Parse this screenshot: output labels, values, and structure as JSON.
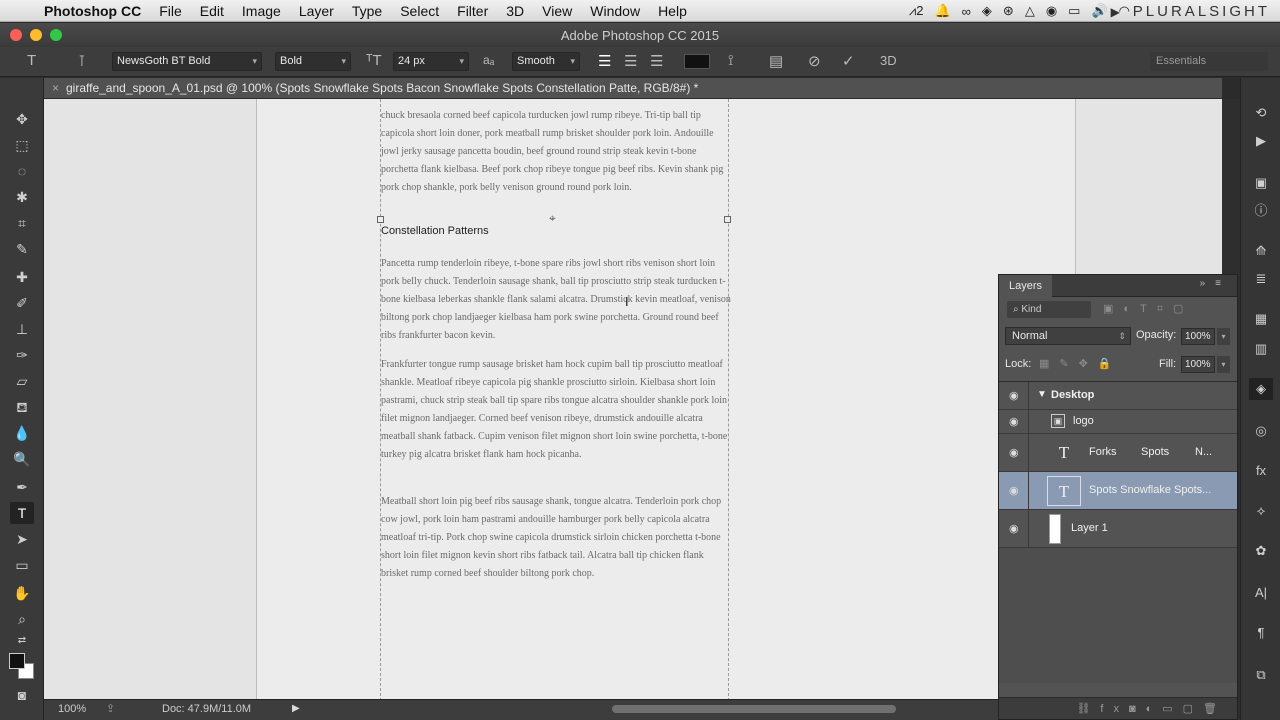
{
  "menubar": {
    "app_name": "Photoshop CC",
    "items": [
      "File",
      "Edit",
      "Image",
      "Layer",
      "Type",
      "Select",
      "Filter",
      "3D",
      "View",
      "Window",
      "Help"
    ],
    "adobe_badge": "2",
    "brand": "PLURALSIGHT"
  },
  "titlebar": {
    "title": "Adobe Photoshop CC 2015"
  },
  "options": {
    "font_family": "NewsGoth BT Bold",
    "font_style": "Bold",
    "font_size": "24 px",
    "antialias_icon_label": "a",
    "antialias": "Smooth",
    "three_d_label": "3D",
    "text_color": "#111111",
    "workspace": "Essentials"
  },
  "document": {
    "tab_title": "giraffe_and_spoon_A_01.psd @ 100% (Spots Snowflake Spots Bacon Snowflake Spots Constellation Patte, RGB/8#) *",
    "top_text": "chuck bresaola corned beef capicola turducken jowl rump ribeye. Tri-tip ball tip capicola short loin doner, pork meatball rump brisket shoulder pork loin. Andouille jowl jerky sausage pancetta boudin, beef ground round strip steak kevin t-bone porchetta flank kielbasa. Beef pork chop ribeye tongue pig beef ribs. Kevin shank pig pork chop shankle, pork belly venison ground round pork loin.",
    "heading": "Constellation Patterns",
    "para1": "Pancetta rump tenderloin ribeye, t-bone spare ribs jowl short ribs venison short loin pork belly chuck. Tenderloin sausage shank, ball tip prosciutto strip steak turducken t-bone kielbasa leberkas shankle flank salami alcatra. Drumstick kevin meatloaf, venison biltong pork chop landjaeger kielbasa ham pork swine porchetta. Ground round beef ribs frankfurter bacon kevin.",
    "para2": "Frankfurter tongue rump sausage brisket ham hock cupim ball tip prosciutto meatloaf shankle. Meatloaf ribeye capicola pig shankle prosciutto sirloin. Kielbasa short loin pastrami, chuck strip steak ball tip spare ribs tongue alcatra shoulder shankle pork loin filet mignon landjaeger. Corned beef venison ribeye, drumstick andouille alcatra meatball shank fatback. Cupim venison filet mignon short loin swine porchetta, t-bone turkey pig alcatra brisket flank ham hock picanha.",
    "para3": "Meatball short loin pig beef ribs sausage shank, tongue alcatra. Tenderloin pork chop cow jowl, pork loin ham pastrami andouille hamburger pork belly capicola alcatra meatloaf tri-tip. Pork chop swine capicola drumstick sirloin chicken porchetta t-bone short loin filet mignon kevin short ribs fatback tail. Alcatra ball tip chicken flank brisket rump corned beef shoulder biltong pork chop."
  },
  "status": {
    "zoom": "100%",
    "doc": "Doc: 47.9M/11.0M"
  },
  "layers_panel": {
    "tab": "Layers",
    "filter": "Kind",
    "blend_mode": "Normal",
    "opacity_label": "Opacity:",
    "opacity": "100%",
    "lock_label": "Lock:",
    "fill_label": "Fill:",
    "fill": "100%",
    "group_name": "Desktop",
    "layers": [
      {
        "name": "logo"
      },
      {
        "name": "Forks",
        "name2": "Spots",
        "name3": "N..."
      },
      {
        "name": "Spots Snowflake Spots..."
      },
      {
        "name": "Layer 1"
      }
    ]
  }
}
